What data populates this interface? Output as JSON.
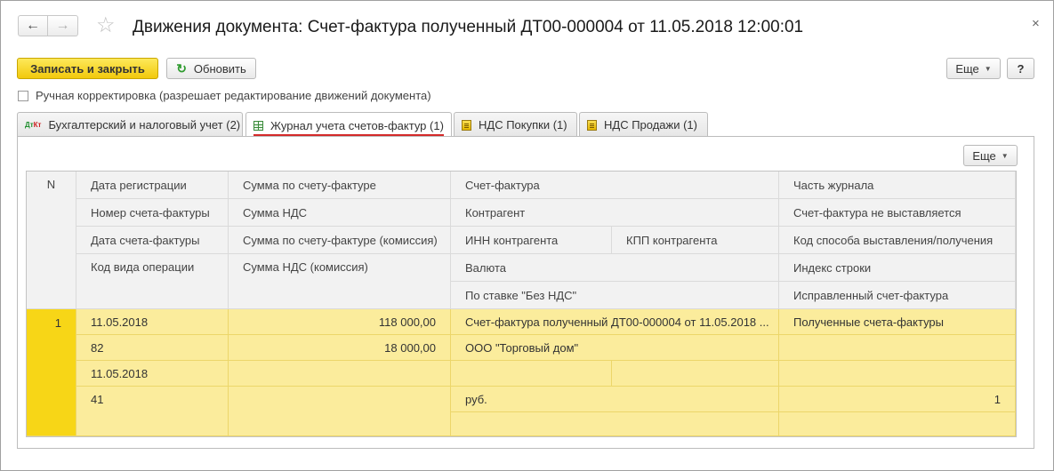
{
  "window": {
    "title": "Движения документа: Счет-фактура полученный ДТ00-000004 от 11.05.2018 12:00:01",
    "nav_back": "←",
    "nav_forward": "→",
    "favorite_glyph": "☆",
    "close_glyph": "×"
  },
  "toolbar": {
    "save_close_label": "Записать и закрыть",
    "refresh_label": "Обновить",
    "refresh_glyph": "↻",
    "more_label": "Еще",
    "help_label": "?"
  },
  "manual_correction": {
    "label": "Ручная корректировка (разрешает редактирование движений документа)",
    "checked": false
  },
  "tabs": [
    {
      "label": "Бухгалтерский и налоговый учет (2)",
      "icon": "dt-kt-icon",
      "icon_top": "Дт",
      "icon_bottom": "Кт",
      "active": false
    },
    {
      "label": "Журнал учета счетов-фактур (1)",
      "icon": "grid-icon",
      "active": true
    },
    {
      "label": "НДС Покупки (1)",
      "icon": "register-icon",
      "active": false
    },
    {
      "label": "НДС Продажи (1)",
      "icon": "register-icon",
      "active": false
    }
  ],
  "inner_toolbar": {
    "more_label": "Еще"
  },
  "table": {
    "n_header": "N",
    "headers": {
      "c1": [
        "Дата регистрации",
        "Номер счета-фактуры",
        "Дата счета-фактуры",
        "Код вида операции"
      ],
      "c2": [
        "Сумма по счету-фактуре",
        "Сумма НДС",
        "Сумма по счету-фактуре (комиссия)",
        "Сумма НДС (комиссия)"
      ],
      "c3": [
        "Счет-фактура",
        "Контрагент",
        "ИНН контрагента",
        "Валюта",
        "По ставке \"Без НДС\""
      ],
      "c3b": "КПП контрагента",
      "c4": [
        "Часть журнала",
        "Счет-фактура не выставляется",
        "Код способа выставления/получения",
        "Индекс строки",
        "Исправленный счет-фактура"
      ]
    },
    "rows": [
      {
        "n": "1",
        "c1": [
          "11.05.2018",
          "82",
          "11.05.2018",
          "41"
        ],
        "c2": [
          "118 000,00",
          "18 000,00",
          "",
          ""
        ],
        "c3": [
          "Счет-фактура полученный ДТ00-000004 от 11.05.2018 ...",
          "ООО \"Торговый дом\"",
          "",
          "руб.",
          ""
        ],
        "c3b": "",
        "c4": [
          "Полученные счета-фактуры",
          "",
          "",
          "1",
          ""
        ]
      }
    ]
  },
  "colors": {
    "primary_button": "#f2c90c",
    "selected_row": "#fbec9c",
    "selected_n_cell": "#f7d617",
    "active_tab_underline": "#d42a2a"
  }
}
